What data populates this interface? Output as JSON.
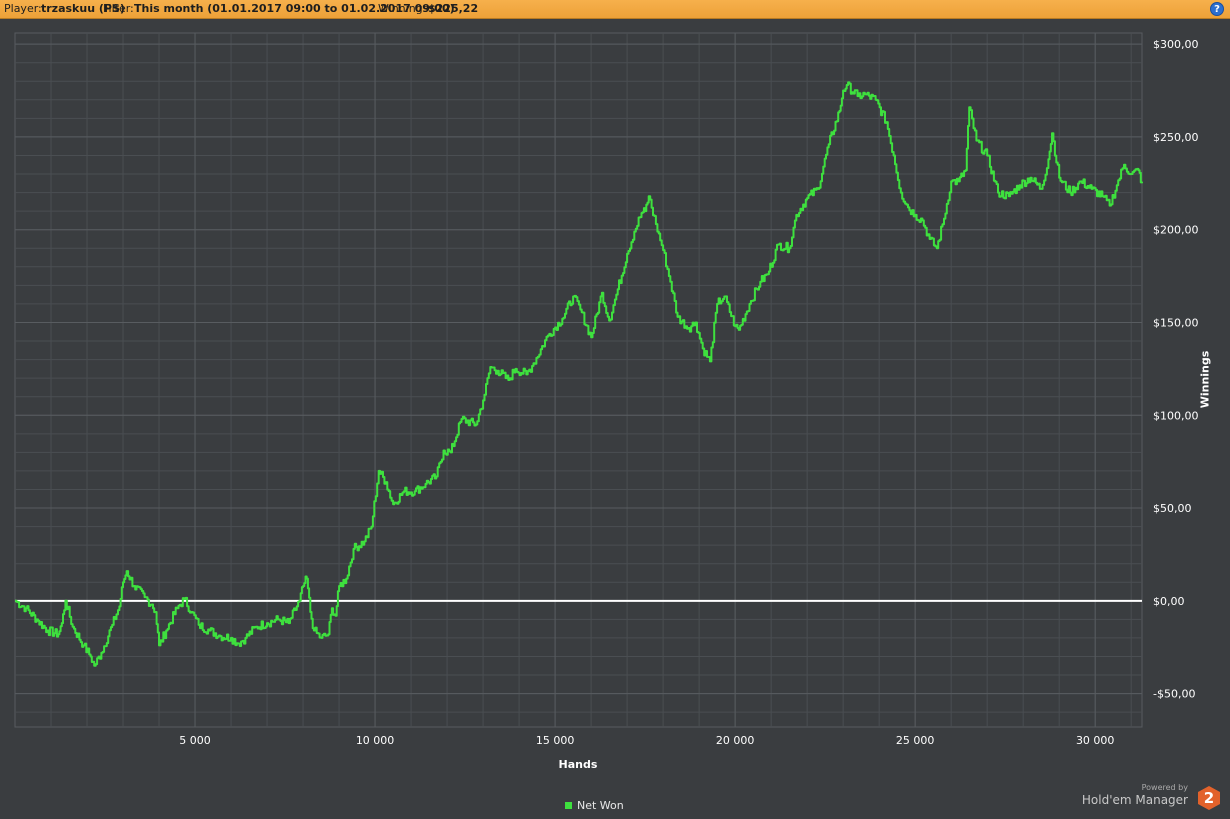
{
  "header": {
    "player_label": "Player:",
    "player_value": "trzaskuu (PS)",
    "filter_label": "Filter:",
    "filter_value": "This month (01.01.2017 09:00 to 01.02.2017 09:00)",
    "winnings_label": "Winnings:",
    "winnings_value": "$225,22",
    "help_label": "?"
  },
  "brand": {
    "powered_by": "Powered by",
    "name": "Hold'em Manager",
    "logo_number": "2",
    "logo_color": "#e2622b"
  },
  "colors": {
    "background": "#3a3d40",
    "grid": "#585c60",
    "line": "#3ee03e",
    "zero_line": "#ffffff",
    "header_bar": "#f0a63e"
  },
  "chart_data": {
    "type": "line",
    "xlabel": "Hands",
    "ylabel": "Winnings",
    "xlim": [
      0,
      31300
    ],
    "ylim": [
      -68,
      306
    ],
    "xticks": [
      5000,
      10000,
      15000,
      20000,
      25000,
      30000
    ],
    "xtick_labels": [
      "5 000",
      "10 000",
      "15 000",
      "20 000",
      "25 000",
      "30 000"
    ],
    "yticks": [
      -50,
      0,
      50,
      100,
      150,
      200,
      250,
      300
    ],
    "ytick_labels": [
      "-$50,00",
      "$0,00",
      "$50,00",
      "$100,00",
      "$150,00",
      "$200,00",
      "$250,00",
      "$300,00"
    ],
    "grid": true,
    "legend_position": "bottom-center",
    "reference_line": 0,
    "series": [
      {
        "name": "Net Won",
        "x": [
          0,
          300,
          600,
          900,
          1200,
          1300,
          1400,
          1600,
          1900,
          2100,
          2200,
          2400,
          2700,
          2900,
          3000,
          3100,
          3300,
          3600,
          3800,
          3900,
          4000,
          4200,
          4500,
          4700,
          4900,
          5100,
          5400,
          5700,
          6000,
          6200,
          6400,
          6700,
          7000,
          7300,
          7600,
          7900,
          8000,
          8100,
          8200,
          8300,
          8500,
          8700,
          8800,
          8900,
          9000,
          9200,
          9400,
          9700,
          9900,
          10100,
          10300,
          10500,
          10800,
          11100,
          11400,
          11700,
          11900,
          12100,
          12400,
          12800,
          13000,
          13200,
          13400,
          13700,
          13900,
          14200,
          14400,
          14800,
          15200,
          15500,
          15700,
          16000,
          16300,
          16500,
          16700,
          17000,
          17200,
          17400,
          17500,
          17600,
          17800,
          18000,
          18200,
          18400,
          18700,
          18900,
          19100,
          19300,
          19500,
          19700,
          20000,
          20100,
          20400,
          20700,
          20900,
          21200,
          21500,
          21700,
          22000,
          22300,
          22600,
          22900,
          23000,
          23100,
          23400,
          23600,
          23900,
          24200,
          24400,
          24600,
          24800,
          25000,
          25200,
          25400,
          25600,
          25800,
          26000,
          26200,
          26400,
          26500,
          26700,
          27000,
          27300,
          27600,
          27900,
          28200,
          28500,
          28700,
          28800,
          29000,
          29300,
          29600,
          29900,
          30200,
          30400,
          30600,
          30800,
          31000,
          31200,
          31300
        ],
        "values": [
          0,
          -4,
          -10,
          -16,
          -18,
          -12,
          0,
          -14,
          -24,
          -30,
          -35,
          -28,
          -13,
          -3,
          10,
          16,
          8,
          2,
          -2,
          -6,
          -24,
          -16,
          -4,
          1,
          -6,
          -13,
          -16,
          -19,
          -20,
          -23,
          -20,
          -14,
          -12,
          -10,
          -12,
          0,
          8,
          12,
          -6,
          -16,
          -20,
          -18,
          -4,
          -8,
          8,
          12,
          28,
          32,
          40,
          70,
          64,
          52,
          59,
          59,
          63,
          67,
          81,
          80,
          98,
          95,
          108,
          126,
          124,
          119,
          125,
          122,
          128,
          143,
          152,
          164,
          157,
          142,
          166,
          151,
          165,
          187,
          199,
          209,
          210,
          218,
          203,
          189,
          172,
          153,
          147,
          150,
          136,
          129,
          160,
          164,
          148,
          146,
          160,
          172,
          176,
          192,
          190,
          208,
          217,
          222,
          246,
          264,
          275,
          278,
          272,
          273,
          270,
          258,
          240,
          220,
          212,
          208,
          205,
          195,
          190,
          206,
          226,
          226,
          232,
          266,
          248,
          240,
          220,
          218,
          224,
          228,
          222,
          238,
          252,
          228,
          220,
          226,
          222,
          218,
          213,
          224,
          235,
          230,
          232,
          225
        ]
      }
    ]
  }
}
